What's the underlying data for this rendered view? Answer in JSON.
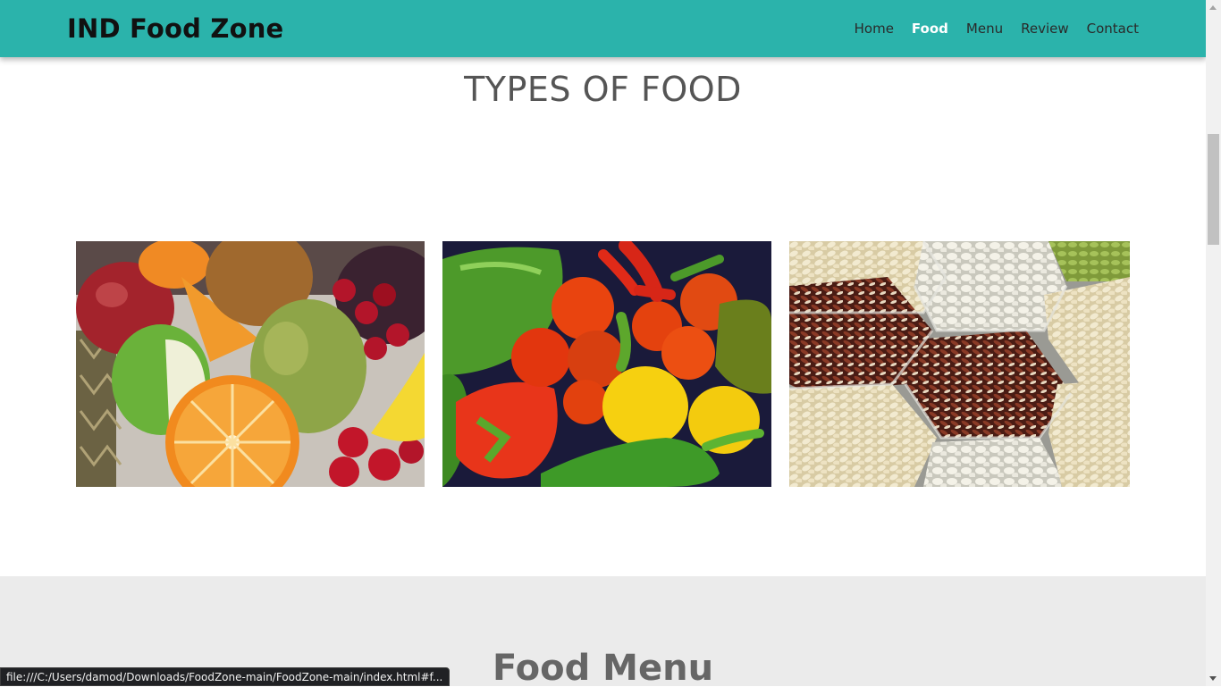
{
  "navbar": {
    "brand": "IND Food Zone",
    "links": [
      {
        "label": "Home",
        "active": false
      },
      {
        "label": "Food",
        "active": true
      },
      {
        "label": "Menu",
        "active": false
      },
      {
        "label": "Review",
        "active": false
      },
      {
        "label": "Contact",
        "active": false
      }
    ],
    "background_color": "#2bb3ab"
  },
  "food_section": {
    "title": "TYPES OF FOOD",
    "images": [
      {
        "subject": "fruits-photo"
      },
      {
        "subject": "vegetables-photo"
      },
      {
        "subject": "grains-photo"
      }
    ]
  },
  "menu_section": {
    "title": "Food Menu",
    "background_color": "#ebebeb"
  },
  "status_bar": {
    "url": "file:///C:/Users/damod/Downloads/FoodZone-main/FoodZone-main/index.html#f..."
  }
}
